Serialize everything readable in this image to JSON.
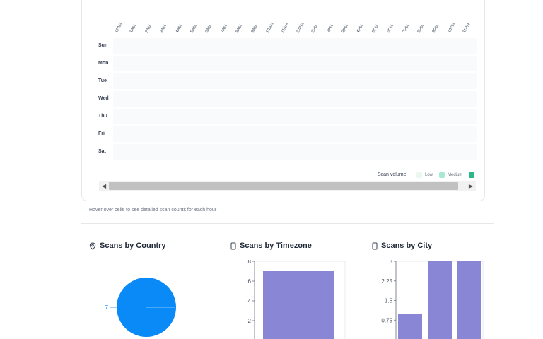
{
  "heatmap": {
    "hours": [
      "12AM",
      "1AM",
      "2AM",
      "3AM",
      "4AM",
      "5AM",
      "6AM",
      "7AM",
      "8AM",
      "9AM",
      "10AM",
      "11AM",
      "12PM",
      "1PM",
      "2PM",
      "3PM",
      "4PM",
      "5PM",
      "6PM",
      "7PM",
      "8PM",
      "9PM",
      "10PM",
      "11PM"
    ],
    "days": [
      "Sun",
      "Mon",
      "Tue",
      "Wed",
      "Thu",
      "Fri",
      "Sat"
    ],
    "legend_label": "Scan volume:",
    "legend_low": "Low",
    "legend_medium": "Medium",
    "legend_colors": [
      "#ecf7f2",
      "#a7e8d0",
      "#2bb886"
    ],
    "hint": "Hover over cells to see detailed scan counts for each hour"
  },
  "sections": {
    "country": {
      "title": "Scans by Country",
      "icon": "location-pin-icon"
    },
    "timezone": {
      "title": "Scans by Timezone",
      "icon": "device-icon"
    },
    "city": {
      "title": "Scans by City",
      "icon": "device-icon"
    }
  },
  "chart_data": [
    {
      "type": "pie",
      "labels": [
        "7"
      ],
      "values": [
        7
      ],
      "colors": [
        "#0a8af7"
      ]
    },
    {
      "type": "bar",
      "yticks": [
        "8",
        "6",
        "4",
        "2"
      ],
      "ylim": [
        0,
        8
      ],
      "values": [
        7
      ],
      "color": "#8a86d6"
    },
    {
      "type": "bar",
      "yticks": [
        "3",
        "2.25",
        "1.5",
        "0.75"
      ],
      "ylim": [
        0,
        3
      ],
      "values": [
        1,
        3,
        3
      ],
      "color": "#8a86d6"
    }
  ]
}
